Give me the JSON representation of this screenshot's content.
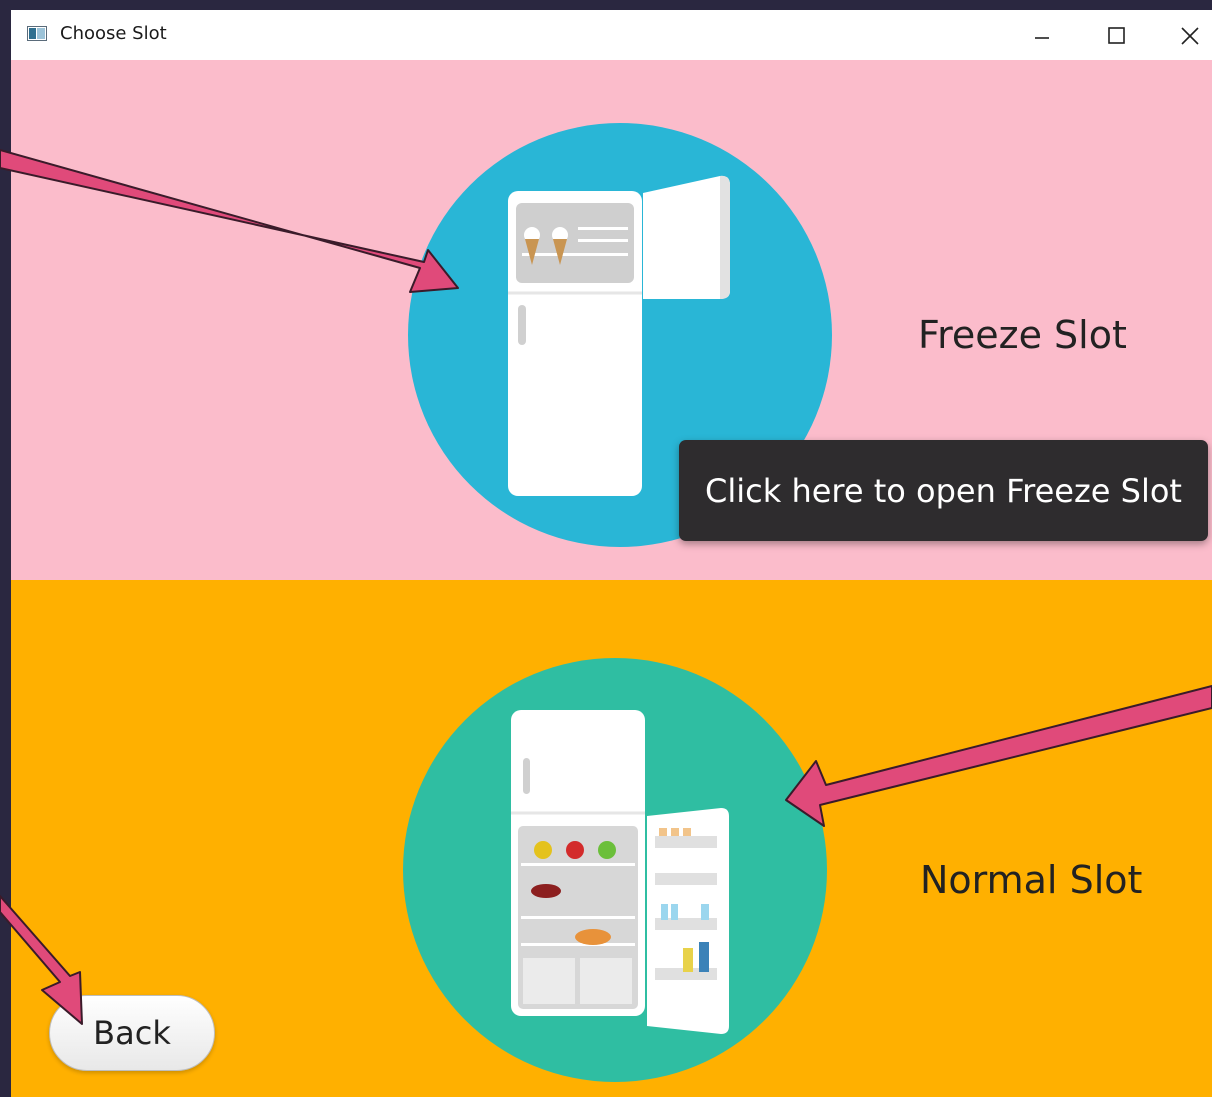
{
  "window": {
    "title": "Choose Slot",
    "app_icon": "window-app-icon",
    "controls": {
      "minimize": "minimize-icon",
      "maximize": "maximize-icon",
      "close": "close-icon"
    }
  },
  "freeze_slot": {
    "label": "Freeze Slot",
    "tooltip": "Click here to open Freeze Slot",
    "icon": "freezer-fridge-icon",
    "background_color": "#fbbccb",
    "circle_color": "#29b6d6"
  },
  "normal_slot": {
    "label": "Normal Slot",
    "icon": "fridge-icon",
    "background_color": "#ffb000",
    "circle_color": "#2fbea2"
  },
  "back_button": {
    "label": "Back"
  },
  "annotations": {
    "arrow_color": "#e04a7a"
  }
}
